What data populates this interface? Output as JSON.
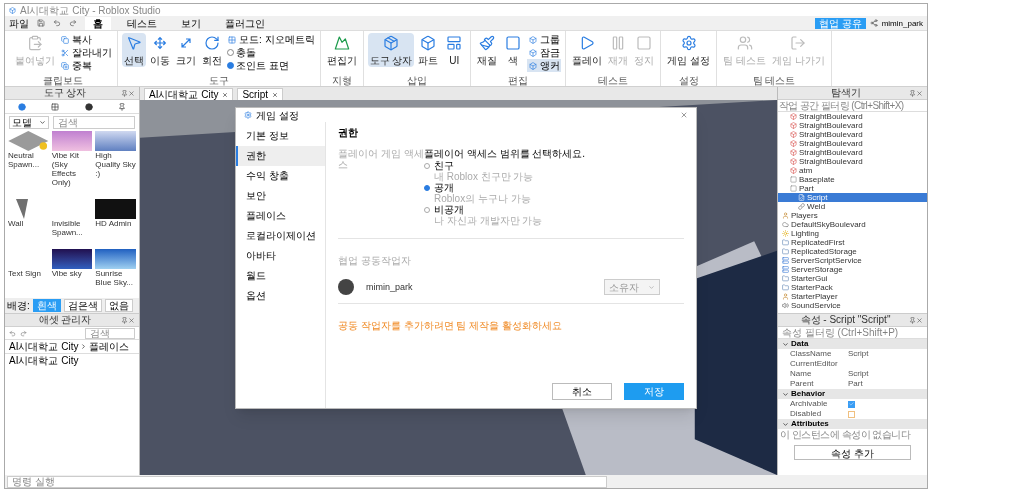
{
  "window": {
    "title": "AI시대학교 City - Roblox Studio"
  },
  "menu": {
    "file": "파일",
    "tabs": [
      {
        "label": "홈",
        "selected": true
      },
      {
        "label": "테스트",
        "selected": false
      },
      {
        "label": "보기",
        "selected": false
      },
      {
        "label": "플러그인",
        "selected": false
      }
    ]
  },
  "top_right": {
    "share_button": "협업 공유",
    "user": "mimin_park"
  },
  "ribbon": [
    {
      "label": "클립보드",
      "large": [
        {
          "label": "붙여넣기",
          "disabled": true
        }
      ],
      "small": [
        {
          "label": "복사",
          "kind": "button",
          "checked": false
        },
        {
          "label": "잘라내기",
          "kind": "button",
          "checked": false
        },
        {
          "label": "중복",
          "kind": "button",
          "checked": false
        }
      ]
    },
    {
      "label": "도구",
      "large": [
        {
          "label": "선택",
          "disabled": false,
          "selected": true
        },
        {
          "label": "이동",
          "disabled": false,
          "selected": false
        },
        {
          "label": "크기",
          "disabled": false,
          "selected": false
        },
        {
          "label": "회전",
          "disabled": false,
          "selected": false
        }
      ],
      "small": [
        {
          "label": "모드: 지오메트릭",
          "kind": "button",
          "checked": false
        },
        {
          "label": "충돌",
          "kind": "check",
          "checked": false
        },
        {
          "label": "조인트 표면",
          "kind": "check",
          "checked": true
        }
      ]
    },
    {
      "label": "지형",
      "large": [
        {
          "label": "편집기",
          "disabled": false,
          "selected": false
        }
      ]
    },
    {
      "label": "삽입",
      "large": [
        {
          "label": "도구 상자",
          "disabled": false,
          "selected": true
        },
        {
          "label": "파트",
          "disabled": false,
          "selected": false
        },
        {
          "label": "UI",
          "disabled": false,
          "selected": false
        }
      ]
    },
    {
      "label": "편집",
      "large": [
        {
          "label": "재질",
          "disabled": false,
          "selected": false
        },
        {
          "label": "색",
          "disabled": false,
          "selected": false
        }
      ],
      "small": [
        {
          "label": "그룹",
          "kind": "button",
          "checked": false
        },
        {
          "label": "잠금",
          "kind": "button",
          "checked": false
        },
        {
          "label": "앵커",
          "kind": "button",
          "checked": true
        }
      ]
    },
    {
      "label": "테스트",
      "large": [
        {
          "label": "플레이",
          "disabled": false,
          "selected": false
        },
        {
          "label": "재개",
          "disabled": true,
          "selected": false
        },
        {
          "label": "정지",
          "disabled": true,
          "selected": false
        }
      ]
    },
    {
      "label": "설정",
      "large": [
        {
          "label": "게임 설정",
          "disabled": false,
          "selected": false
        }
      ]
    },
    {
      "label": "팀 테스트",
      "large": [
        {
          "label": "팀 테스트",
          "disabled": true,
          "selected": false
        },
        {
          "label": "게임 나가기",
          "disabled": true,
          "selected": false
        }
      ]
    }
  ],
  "toolbox": {
    "title": "도구 상자",
    "category": "모델",
    "search": {
      "placeholder": "검색"
    },
    "assets": [
      {
        "name": "Neutral Spawn...",
        "kind": "spawn"
      },
      {
        "name": "Vibe Kit (Sky Effects Only)",
        "kind": "sunset"
      },
      {
        "name": "High Quality Sky :)",
        "kind": "sky"
      },
      {
        "name": "Wall",
        "kind": "wall"
      },
      {
        "name": "Invisible Spawn...",
        "kind": "empty"
      },
      {
        "name": "HD Admin",
        "kind": "dark"
      },
      {
        "name": "Text Sign",
        "kind": "empty"
      },
      {
        "name": "Vibe sky",
        "kind": "night"
      },
      {
        "name": "Sunrise Blue Sky...",
        "kind": "blue"
      }
    ],
    "background": {
      "label": "배경:",
      "options": [
        {
          "label": "흰색",
          "selected": true
        },
        {
          "label": "검은색",
          "selected": false
        },
        {
          "label": "없음",
          "selected": false
        }
      ]
    }
  },
  "asset_manager": {
    "title": "애셋 관리자",
    "search": {
      "placeholder": "검색"
    },
    "breadcrumb": [
      "AI시대학교 City",
      "플레이스"
    ],
    "items": [
      "AI시대학교 City"
    ]
  },
  "doc_tabs": [
    {
      "label": "AI시대학교 City"
    },
    {
      "label": "Script"
    }
  ],
  "dialog": {
    "title": "게임 설정",
    "nav": [
      {
        "label": "기본 정보",
        "selected": false
      },
      {
        "label": "권한",
        "selected": true
      },
      {
        "label": "수익 창출",
        "selected": false
      },
      {
        "label": "보안",
        "selected": false
      },
      {
        "label": "플레이스",
        "selected": false
      },
      {
        "label": "로컬라이제이션",
        "selected": false
      },
      {
        "label": "아바타",
        "selected": false
      },
      {
        "label": "월드",
        "selected": false
      },
      {
        "label": "옵션",
        "selected": false
      }
    ],
    "heading": "권한",
    "access_label": "플레이어 게임 액세스",
    "access_prompt": "플레이어 액세스 범위를 선택하세요.",
    "access_options": [
      {
        "label": "친구",
        "hint": "내 Roblox 친구만 가능",
        "selected": false
      },
      {
        "label": "공개",
        "hint": "Roblox의 누구나 가능",
        "selected": true
      },
      {
        "label": "비공개",
        "hint": "나 자신과 개발자만 가능",
        "selected": false
      }
    ],
    "collaborators_label": "협업 공동작업자",
    "collaborator": {
      "name": "mimin_park",
      "role": "소유자"
    },
    "warning": "공동 작업자를 추가하려면 팀 제작을 활성화하세요",
    "buttons": {
      "cancel": "취소",
      "save": "저장"
    }
  },
  "explorer": {
    "title": "탐색기",
    "filter": {
      "placeholder": "작업 공간 필터링 (Ctrl+Shift+X)"
    },
    "tree": [
      {
        "label": "StraightBoulevard",
        "kind": "model",
        "selected": false
      },
      {
        "label": "StraightBoulevard",
        "kind": "model",
        "selected": false
      },
      {
        "label": "StraightBoulevard",
        "kind": "model",
        "selected": false
      },
      {
        "label": "StraightBoulevard",
        "kind": "model",
        "selected": false
      },
      {
        "label": "StraightBoulevard",
        "kind": "model",
        "selected": false
      },
      {
        "label": "StraightBoulevard",
        "kind": "model",
        "selected": false
      },
      {
        "label": "atm",
        "kind": "model",
        "selected": false
      },
      {
        "label": "Baseplate",
        "kind": "part",
        "selected": false
      },
      {
        "label": "Part",
        "kind": "part",
        "selected": false,
        "children": [
          {
            "label": "Script",
            "kind": "script",
            "selected": true
          },
          {
            "label": "Weld",
            "kind": "weld",
            "selected": false
          }
        ]
      }
    ],
    "services": [
      {
        "label": "Players",
        "kind": "players"
      },
      {
        "label": "DefaultSkyBoulevard",
        "kind": "sky"
      },
      {
        "label": "Lighting",
        "kind": "light"
      },
      {
        "label": "ReplicatedFirst",
        "kind": "folder"
      },
      {
        "label": "ReplicatedStorage",
        "kind": "folder"
      },
      {
        "label": "ServerScriptService",
        "kind": "service"
      },
      {
        "label": "ServerStorage",
        "kind": "service"
      },
      {
        "label": "StarterGui",
        "kind": "folder"
      },
      {
        "label": "StarterPack",
        "kind": "folder"
      },
      {
        "label": "StarterPlayer",
        "kind": "players"
      },
      {
        "label": "SoundService",
        "kind": "sound"
      }
    ]
  },
  "properties": {
    "title": "속성 - Script \"Script\"",
    "filter": {
      "placeholder": "속성 필터링 (Ctrl+Shift+P)"
    },
    "sections": [
      {
        "name": "Data",
        "rows": [
          {
            "name": "ClassName",
            "kind": "text",
            "value": "Script"
          },
          {
            "name": "CurrentEditor",
            "kind": "text"
          },
          {
            "name": "Name",
            "kind": "text",
            "value": "Script"
          },
          {
            "name": "Parent",
            "kind": "text",
            "value": "Part"
          }
        ]
      },
      {
        "name": "Behavior",
        "rows": [
          {
            "name": "Archivable",
            "kind": "check",
            "checked": true
          },
          {
            "name": "Disabled",
            "kind": "check",
            "checked": false
          }
        ]
      },
      {
        "name": "Attributes"
      }
    ],
    "attributes_note": "이 인스턴스에 속성이 없습니다",
    "add_button": "속성 추가"
  },
  "status_bar": {
    "command_placeholder": "명령 실행"
  }
}
